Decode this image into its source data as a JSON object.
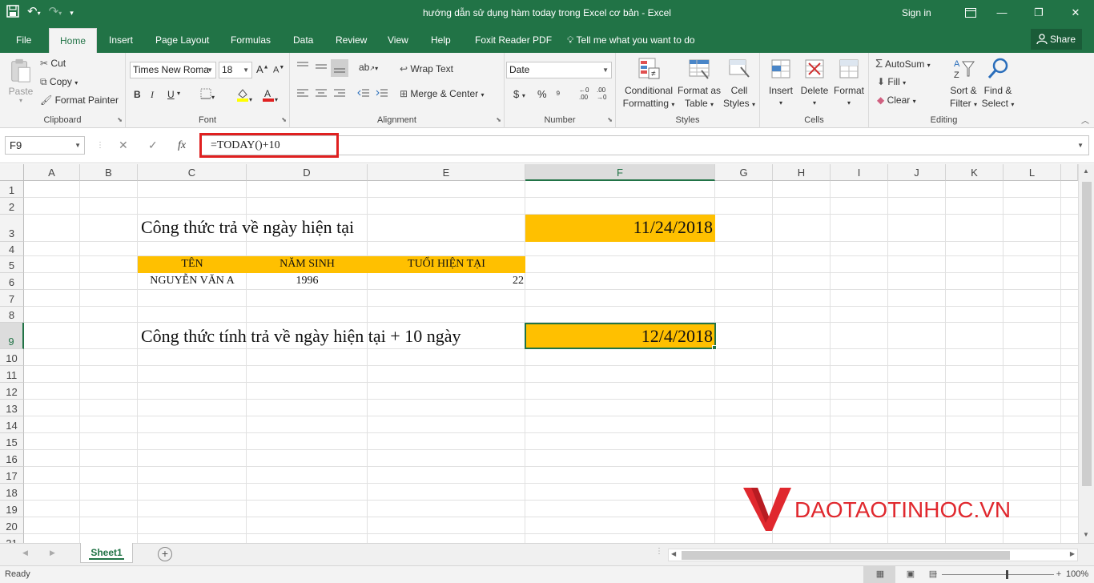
{
  "window": {
    "title": "hướng dẫn sử dụng hàm today trong Excel cơ bản  -  Excel",
    "signin": "Sign in",
    "qat_icons": [
      "save-icon",
      "undo-icon",
      "redo-icon",
      "customize-icon"
    ]
  },
  "menu": {
    "tabs": [
      "File",
      "Home",
      "Insert",
      "Page Layout",
      "Formulas",
      "Data",
      "Review",
      "View",
      "Help",
      "Foxit Reader PDF"
    ],
    "active_tab": "Home",
    "tell_me": "Tell me what you want to do",
    "share": "Share"
  },
  "ribbon": {
    "clipboard": {
      "paste": "Paste",
      "cut": "Cut",
      "copy": "Copy",
      "format_painter": "Format Painter",
      "label": "Clipboard"
    },
    "font": {
      "name": "Times New Roma",
      "size": "18",
      "bold": "B",
      "italic": "I",
      "underline": "U",
      "label": "Font",
      "font_color": "#e02020",
      "fill_color": "#ffff00"
    },
    "alignment": {
      "wrap_text": "Wrap Text",
      "merge_center": "Merge & Center",
      "label": "Alignment"
    },
    "number": {
      "format": "Date",
      "currency": "$",
      "percent": "%",
      "label": "Number"
    },
    "styles": {
      "conditional": "Conditional",
      "conditional2": "Formatting",
      "format_as": "Format as",
      "format_as2": "Table",
      "cell_styles": "Cell",
      "cell_styles2": "Styles",
      "label": "Styles"
    },
    "cells": {
      "insert": "Insert",
      "delete": "Delete",
      "format": "Format",
      "label": "Cells"
    },
    "editing": {
      "autosum": "AutoSum",
      "fill": "Fill",
      "clear": "Clear",
      "sort": "Sort &",
      "sort2": "Filter",
      "find": "Find &",
      "find2": "Select",
      "label": "Editing"
    }
  },
  "formula_bar": {
    "name_box": "F9",
    "formula": "=TODAY()+10",
    "fx": "fx"
  },
  "sheet": {
    "columns": [
      "A",
      "B",
      "C",
      "D",
      "E",
      "F",
      "G",
      "H",
      "I",
      "J",
      "K",
      "L"
    ],
    "rows": [
      "1",
      "2",
      "3",
      "4",
      "5",
      "6",
      "7",
      "8",
      "9",
      "10",
      "11",
      "12",
      "13",
      "14",
      "15",
      "16",
      "17",
      "18",
      "19",
      "20",
      "21"
    ],
    "selected_cell": "F9",
    "fill_color": "#ffc000",
    "cells": {
      "C3": "Công thức trả về ngày hiện tại",
      "F3": "11/24/2018",
      "C5": "TÊN",
      "D5": "NĂM SINH",
      "E5": "TUỔI HIỆN TẠI",
      "C6": "NGUYỄN VĂN A",
      "D6": "1996",
      "E6": "22",
      "C9": "Công thức tính trả về ngày hiện tại + 10 ngày",
      "F9": "12/4/2018"
    }
  },
  "watermark": {
    "text": "DAOTAOTINHOC.VN",
    "color": "#e0282e"
  },
  "sheet_tabs": {
    "active": "Sheet1"
  },
  "status": {
    "ready": "Ready",
    "zoom": "100%"
  }
}
